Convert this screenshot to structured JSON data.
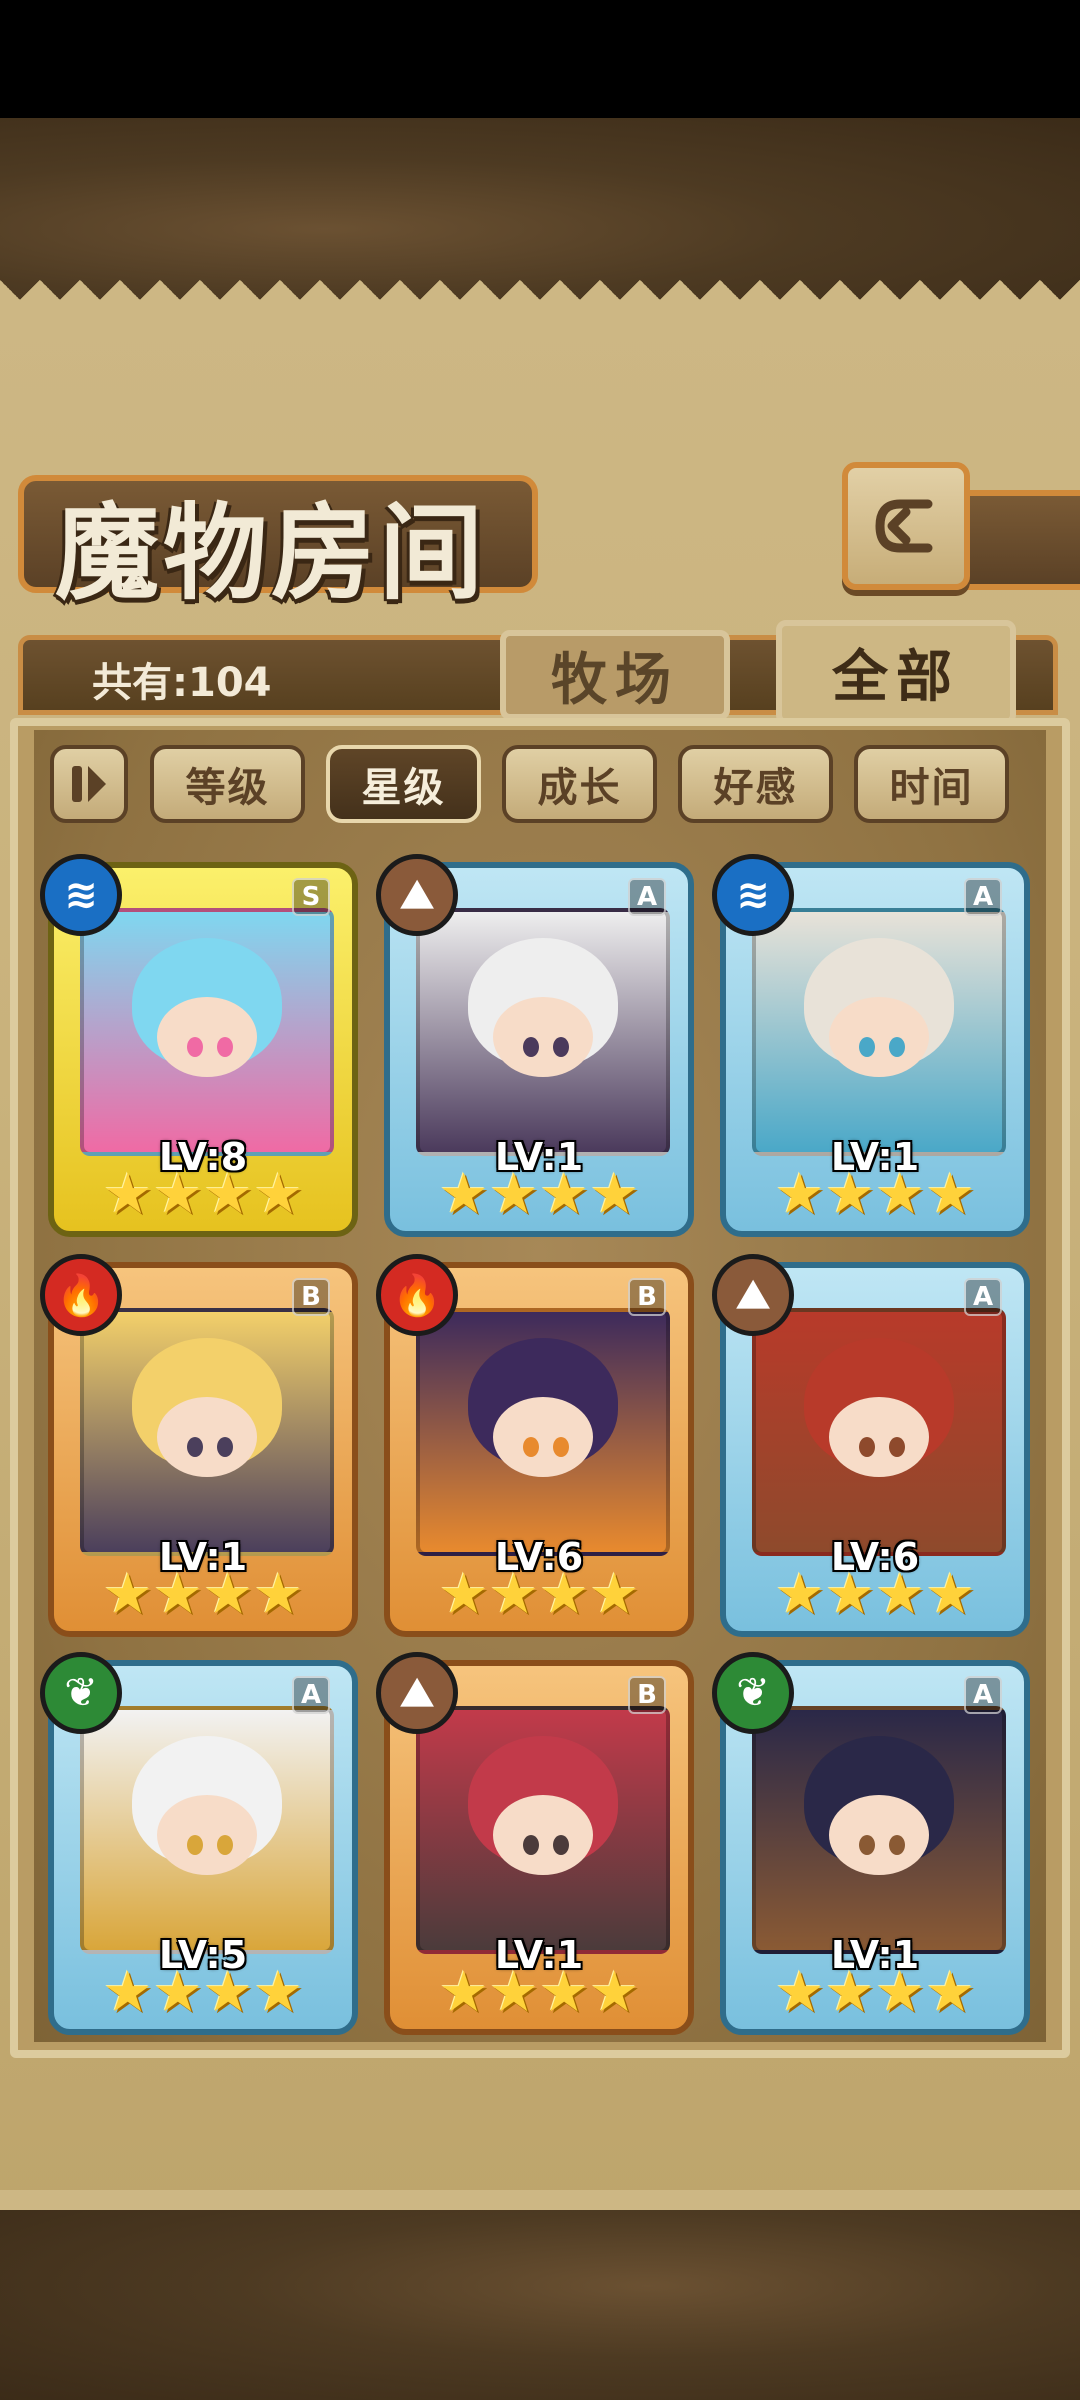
{
  "header": {
    "title": "魔物房间",
    "back_icon": "back-arrow-icon"
  },
  "info": {
    "total": "共有:104"
  },
  "tabs": [
    {
      "label": "牧场",
      "active": false
    },
    {
      "label": "全部",
      "active": true
    }
  ],
  "sort": {
    "toggle_icon": "play-pause-icon",
    "buttons": [
      {
        "label": "等级",
        "active": false
      },
      {
        "label": "星级",
        "active": true
      },
      {
        "label": "成长",
        "active": false
      },
      {
        "label": "好感",
        "active": false
      },
      {
        "label": "时间",
        "active": false
      }
    ]
  },
  "monsters": [
    {
      "level": "LV:8",
      "rank": "S",
      "element": "water",
      "stars": 4,
      "frame": "s",
      "palette": [
        "#7fd7f0",
        "#f06aa4"
      ]
    },
    {
      "level": "LV:1",
      "rank": "A",
      "element": "earth",
      "stars": 4,
      "frame": "a",
      "palette": [
        "#eeeeee",
        "#4b3a5c"
      ]
    },
    {
      "level": "LV:1",
      "rank": "A",
      "element": "water",
      "stars": 4,
      "frame": "a",
      "palette": [
        "#e8e2d8",
        "#4aa8c8"
      ]
    },
    {
      "level": "LV:1",
      "rank": "B",
      "element": "fire",
      "stars": 4,
      "frame": "b",
      "palette": [
        "#f3d06a",
        "#4b3f5c"
      ]
    },
    {
      "level": "LV:6",
      "rank": "B",
      "element": "fire",
      "stars": 4,
      "frame": "b",
      "palette": [
        "#3d2a5c",
        "#e88a2e"
      ]
    },
    {
      "level": "LV:6",
      "rank": "A",
      "element": "earth",
      "stars": 4,
      "frame": "a",
      "palette": [
        "#b83a2a",
        "#8e4a2c"
      ]
    },
    {
      "level": "LV:5",
      "rank": "A",
      "element": "wood",
      "stars": 4,
      "frame": "a",
      "palette": [
        "#f2f2f2",
        "#d9a63a"
      ]
    },
    {
      "level": "LV:1",
      "rank": "B",
      "element": "earth",
      "stars": 4,
      "frame": "b",
      "palette": [
        "#c23a4a",
        "#4b3b3b"
      ]
    },
    {
      "level": "LV:1",
      "rank": "A",
      "element": "wood",
      "stars": 4,
      "frame": "a",
      "palette": [
        "#2a2848",
        "#8a5a34"
      ]
    }
  ]
}
